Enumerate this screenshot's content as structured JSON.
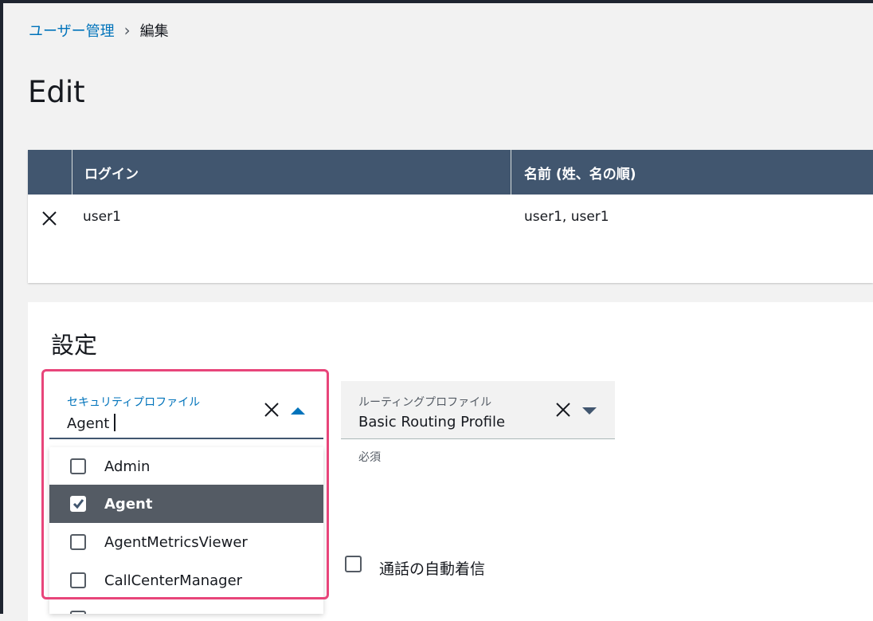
{
  "breadcrumb": {
    "parent": "ユーザー管理",
    "separator": "›",
    "current": "編集"
  },
  "page_title": "Edit",
  "users_table": {
    "headers": [
      "",
      "ログイン",
      "名前 (姓、名の順)"
    ],
    "rows": [
      {
        "login": "user1",
        "name": "user1, user1"
      }
    ]
  },
  "settings": {
    "title": "設定",
    "security_profile": {
      "label": "セキュリティプロファイル",
      "value": "Agent",
      "options": [
        {
          "label": "Admin",
          "checked": false
        },
        {
          "label": "Agent",
          "checked": true
        },
        {
          "label": "AgentMetricsViewer",
          "checked": false
        },
        {
          "label": "CallCenterManager",
          "checked": false
        }
      ]
    },
    "routing_profile": {
      "label": "ルーティングプロファイル",
      "value": "Basic Routing Profile",
      "helper": "必須"
    },
    "auto_accept": {
      "label": "通話の自動着信",
      "checked": false
    }
  },
  "colors": {
    "accent": "#0073bb",
    "header_bg": "#41566f",
    "selected_bg": "#545b64",
    "highlight": "#e8457a"
  }
}
